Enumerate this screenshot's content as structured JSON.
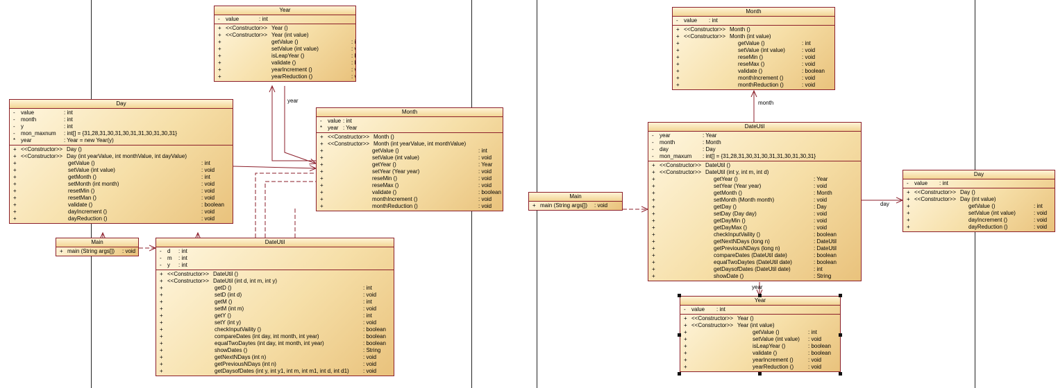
{
  "colors": {
    "border": "#8b1e2a",
    "fill_light": "#fff7e1",
    "fill_dark": "#e9c27c",
    "link": "#8b1e2a"
  },
  "left": {
    "year": {
      "name": "Year",
      "attrs": [
        {
          "v": "-",
          "n": "value",
          "t": ": int"
        }
      ],
      "ops": [
        {
          "v": "+",
          "s": "<<Constructor>>",
          "n": "Year ()",
          "t": ""
        },
        {
          "v": "+",
          "s": "<<Constructor>>",
          "n": "Year (int value)",
          "t": ""
        },
        {
          "v": "+",
          "s": "",
          "n": "getValue ()",
          "t": ": int"
        },
        {
          "v": "+",
          "s": "",
          "n": "setValue (int value)",
          "t": ": void"
        },
        {
          "v": "+",
          "s": "",
          "n": "isLeapYear ()",
          "t": ": boolean"
        },
        {
          "v": "+",
          "s": "",
          "n": "validate ()",
          "t": ": boolean"
        },
        {
          "v": "+",
          "s": "",
          "n": "yearIncrement ()",
          "t": ": void"
        },
        {
          "v": "+",
          "s": "",
          "n": "yearReduction ()",
          "t": ": void"
        }
      ]
    },
    "day": {
      "name": "Day",
      "attrs": [
        {
          "v": "-",
          "n": "value",
          "t": ": int"
        },
        {
          "v": "-",
          "n": "month",
          "t": ": int"
        },
        {
          "v": "-",
          "n": "y",
          "t": ": int"
        },
        {
          "v": "-",
          "n": "mon_maxnum",
          "t": ": int[]     = {31,28,31,30,31,30,31,31,30,31,30,31}"
        },
        {
          "v": "*",
          "n": "year",
          "t": ": Year     = new Year(y)"
        }
      ],
      "ops": [
        {
          "v": "+",
          "s": "<<Constructor>>",
          "n": "Day ()",
          "t": ""
        },
        {
          "v": "+",
          "s": "<<Constructor>>",
          "n": "Day (int yearValue, int monthValue, int dayValue)",
          "t": ""
        },
        {
          "v": "+",
          "s": "",
          "n": "getValue ()",
          "t": ": int"
        },
        {
          "v": "+",
          "s": "",
          "n": "setValue (int value)",
          "t": ": void"
        },
        {
          "v": "+",
          "s": "",
          "n": "getMonth ()",
          "t": ": int"
        },
        {
          "v": "+",
          "s": "",
          "n": "setMonth (int month)",
          "t": ": void"
        },
        {
          "v": "+",
          "s": "",
          "n": "resetMin ()",
          "t": ": void"
        },
        {
          "v": "+",
          "s": "",
          "n": "resetMan ()",
          "t": ": void"
        },
        {
          "v": "+",
          "s": "",
          "n": "validate ()",
          "t": ": boolean"
        },
        {
          "v": "+",
          "s": "",
          "n": "dayIncrement ()",
          "t": ": void"
        },
        {
          "v": "+",
          "s": "",
          "n": "dayReduction ()",
          "t": ": void"
        }
      ]
    },
    "month": {
      "name": "Month",
      "attrs": [
        {
          "v": "-",
          "n": "value",
          "t": ": int"
        },
        {
          "v": "*",
          "n": "year",
          "t": ": Year"
        }
      ],
      "ops": [
        {
          "v": "+",
          "s": "<<Constructor>>",
          "n": "Month ()",
          "t": ""
        },
        {
          "v": "+",
          "s": "<<Constructor>>",
          "n": "Month (int yearValue, int monthValue)",
          "t": ""
        },
        {
          "v": "+",
          "s": "",
          "n": "getValue ()",
          "t": ": int"
        },
        {
          "v": "+",
          "s": "",
          "n": "setValue (int value)",
          "t": ": void"
        },
        {
          "v": "+",
          "s": "",
          "n": "getYear ()",
          "t": ": Year"
        },
        {
          "v": "+",
          "s": "",
          "n": "setYear (Year year)",
          "t": ": void"
        },
        {
          "v": "+",
          "s": "",
          "n": "reseMin ()",
          "t": ": void"
        },
        {
          "v": "+",
          "s": "",
          "n": "reseMax ()",
          "t": ": void"
        },
        {
          "v": "+",
          "s": "",
          "n": "validate ()",
          "t": ": boolean"
        },
        {
          "v": "+",
          "s": "",
          "n": "monthIncrement ()",
          "t": ": void"
        },
        {
          "v": "+",
          "s": "",
          "n": "monthReduction ()",
          "t": ": void"
        }
      ]
    },
    "main": {
      "name": "Main",
      "ops": [
        {
          "v": "+",
          "n": "main (String args[])",
          "t": ": void"
        }
      ]
    },
    "dateutil": {
      "name": "DateUtil",
      "attrs": [
        {
          "v": "-",
          "n": "d",
          "t": ": int"
        },
        {
          "v": "-",
          "n": "m",
          "t": ": int"
        },
        {
          "v": "-",
          "n": "y",
          "t": ": int"
        }
      ],
      "ops": [
        {
          "v": "+",
          "s": "<<Constructor>>",
          "n": "DateUtil ()",
          "t": ""
        },
        {
          "v": "+",
          "s": "<<Constructor>>",
          "n": "DateUtil (int d, int m, int y)",
          "t": ""
        },
        {
          "v": "+",
          "s": "",
          "n": "getD ()",
          "t": ": int"
        },
        {
          "v": "+",
          "s": "",
          "n": "setD (int d)",
          "t": ": void"
        },
        {
          "v": "+",
          "s": "",
          "n": "getM ()",
          "t": ": int"
        },
        {
          "v": "+",
          "s": "",
          "n": "setM (int m)",
          "t": ": void"
        },
        {
          "v": "+",
          "s": "",
          "n": "getY ()",
          "t": ": int"
        },
        {
          "v": "+",
          "s": "",
          "n": "setY (int y)",
          "t": ": void"
        },
        {
          "v": "+",
          "s": "",
          "n": "checkInputVaility ()",
          "t": ": boolean"
        },
        {
          "v": "+",
          "s": "",
          "n": "compareDates (int day, int month, int year)",
          "t": ": boolean"
        },
        {
          "v": "+",
          "s": "",
          "n": "equalTwoDaytes (int day, int month, int year)",
          "t": ": boolean"
        },
        {
          "v": "+",
          "s": "",
          "n": "showDates ()",
          "t": ": String"
        },
        {
          "v": "+",
          "s": "",
          "n": "getNextNDays (int n)",
          "t": ": void"
        },
        {
          "v": "+",
          "s": "",
          "n": "getPreviousNDays (int n)",
          "t": ": void"
        },
        {
          "v": "+",
          "s": "",
          "n": "getDaysofDates (int y, int y1, int m, int m1, int d, int d1)",
          "t": ": void"
        }
      ]
    },
    "label_year": "year"
  },
  "right": {
    "month": {
      "name": "Month",
      "attrs": [
        {
          "v": "-",
          "n": "value",
          "t": ": int"
        }
      ],
      "ops": [
        {
          "v": "+",
          "s": "<<Constructor>>",
          "n": "Month ()",
          "t": ""
        },
        {
          "v": "+",
          "s": "<<Constructor>>",
          "n": "Month (int value)",
          "t": ""
        },
        {
          "v": "+",
          "s": "",
          "n": "getValue ()",
          "t": ": int"
        },
        {
          "v": "+",
          "s": "",
          "n": "setValue (int value)",
          "t": ": void"
        },
        {
          "v": "+",
          "s": "",
          "n": "reseMin ()",
          "t": ": void"
        },
        {
          "v": "+",
          "s": "",
          "n": "reseMax ()",
          "t": ": void"
        },
        {
          "v": "+",
          "s": "",
          "n": "validate ()",
          "t": ": boolean"
        },
        {
          "v": "+",
          "s": "",
          "n": "monthIncrement ()",
          "t": ": void"
        },
        {
          "v": "+",
          "s": "",
          "n": "monthReduction ()",
          "t": ": void"
        }
      ]
    },
    "dateutil": {
      "name": "DateUtil",
      "attrs": [
        {
          "v": "-",
          "n": "year",
          "t": ": Year"
        },
        {
          "v": "-",
          "n": "month",
          "t": ": Month"
        },
        {
          "v": "-",
          "n": "day",
          "t": ": Day"
        },
        {
          "v": "-",
          "n": "mon_maxum",
          "t": ": int[]       = {31,28,31,30,31,30,31,31,30,31,30,31}"
        }
      ],
      "ops": [
        {
          "v": "+",
          "s": "<<Constructor>>",
          "n": "DateUtil ()",
          "t": ""
        },
        {
          "v": "+",
          "s": "<<Constructor>>",
          "n": "DateUtil (int y, int m, int d)",
          "t": ""
        },
        {
          "v": "+",
          "s": "",
          "n": "getYear ()",
          "t": ": Year"
        },
        {
          "v": "+",
          "s": "",
          "n": "setYear (Year year)",
          "t": ": void"
        },
        {
          "v": "+",
          "s": "",
          "n": "getMonth ()",
          "t": ": Month"
        },
        {
          "v": "+",
          "s": "",
          "n": "setMonth (Month month)",
          "t": ": void"
        },
        {
          "v": "+",
          "s": "",
          "n": "getDay ()",
          "t": ": Day"
        },
        {
          "v": "+",
          "s": "",
          "n": "setDay (Day day)",
          "t": ": void"
        },
        {
          "v": "+",
          "s": "",
          "n": "getDayMin ()",
          "t": ": void"
        },
        {
          "v": "+",
          "s": "",
          "n": "getDayMax ()",
          "t": ": void"
        },
        {
          "v": "+",
          "s": "",
          "n": "checkInputVaility ()",
          "t": ": boolean"
        },
        {
          "v": "+",
          "s": "",
          "n": "getNextNDays (long n)",
          "t": ": DateUtil"
        },
        {
          "v": "+",
          "s": "",
          "n": "getPreviousNDays (long n)",
          "t": ": DateUtil"
        },
        {
          "v": "+",
          "s": "",
          "n": "compareDates (DateUtil date)",
          "t": ": boolean"
        },
        {
          "v": "+",
          "s": "",
          "n": "equalTwoDaytes (DateUtil date)",
          "t": ": boolean"
        },
        {
          "v": "+",
          "s": "",
          "n": "getDaysofDates (DateUtil date)",
          "t": ": int"
        },
        {
          "v": "+",
          "s": "",
          "n": "showDate ()",
          "t": ": String"
        }
      ]
    },
    "main": {
      "name": "Main",
      "ops": [
        {
          "v": "+",
          "n": "main (String args[])",
          "t": ": void"
        }
      ]
    },
    "day": {
      "name": "Day",
      "attrs": [
        {
          "v": "-",
          "n": "value",
          "t": ": int"
        }
      ],
      "ops": [
        {
          "v": "+",
          "s": "<<Constructor>>",
          "n": "Day ()",
          "t": ""
        },
        {
          "v": "+",
          "s": "<<Constructor>>",
          "n": "Day (int value)",
          "t": ""
        },
        {
          "v": "+",
          "s": "",
          "n": "getValue ()",
          "t": ": int"
        },
        {
          "v": "+",
          "s": "",
          "n": "setValue (int value)",
          "t": ": void"
        },
        {
          "v": "+",
          "s": "",
          "n": "dayIncrement ()",
          "t": ": void"
        },
        {
          "v": "+",
          "s": "",
          "n": "dayReduction ()",
          "t": ": void"
        }
      ]
    },
    "year": {
      "name": "Year",
      "attrs": [
        {
          "v": "-",
          "n": "value",
          "t": ": int"
        }
      ],
      "ops": [
        {
          "v": "+",
          "s": "<<Constructor>>",
          "n": "Year ()",
          "t": ""
        },
        {
          "v": "+",
          "s": "<<Constructor>>",
          "n": "Year (int value)",
          "t": ""
        },
        {
          "v": "+",
          "s": "",
          "n": "getValue ()",
          "t": ": int"
        },
        {
          "v": "+",
          "s": "",
          "n": "setValue (int value)",
          "t": ": void"
        },
        {
          "v": "+",
          "s": "",
          "n": "isLeapYear ()",
          "t": ": boolean"
        },
        {
          "v": "+",
          "s": "",
          "n": "validate ()",
          "t": ": boolean"
        },
        {
          "v": "+",
          "s": "",
          "n": "yearIncrement ()",
          "t": ": void"
        },
        {
          "v": "+",
          "s": "",
          "n": "yearReduction ()",
          "t": ": void"
        }
      ]
    },
    "label_month": "month",
    "label_day": "day",
    "label_year": "year"
  }
}
